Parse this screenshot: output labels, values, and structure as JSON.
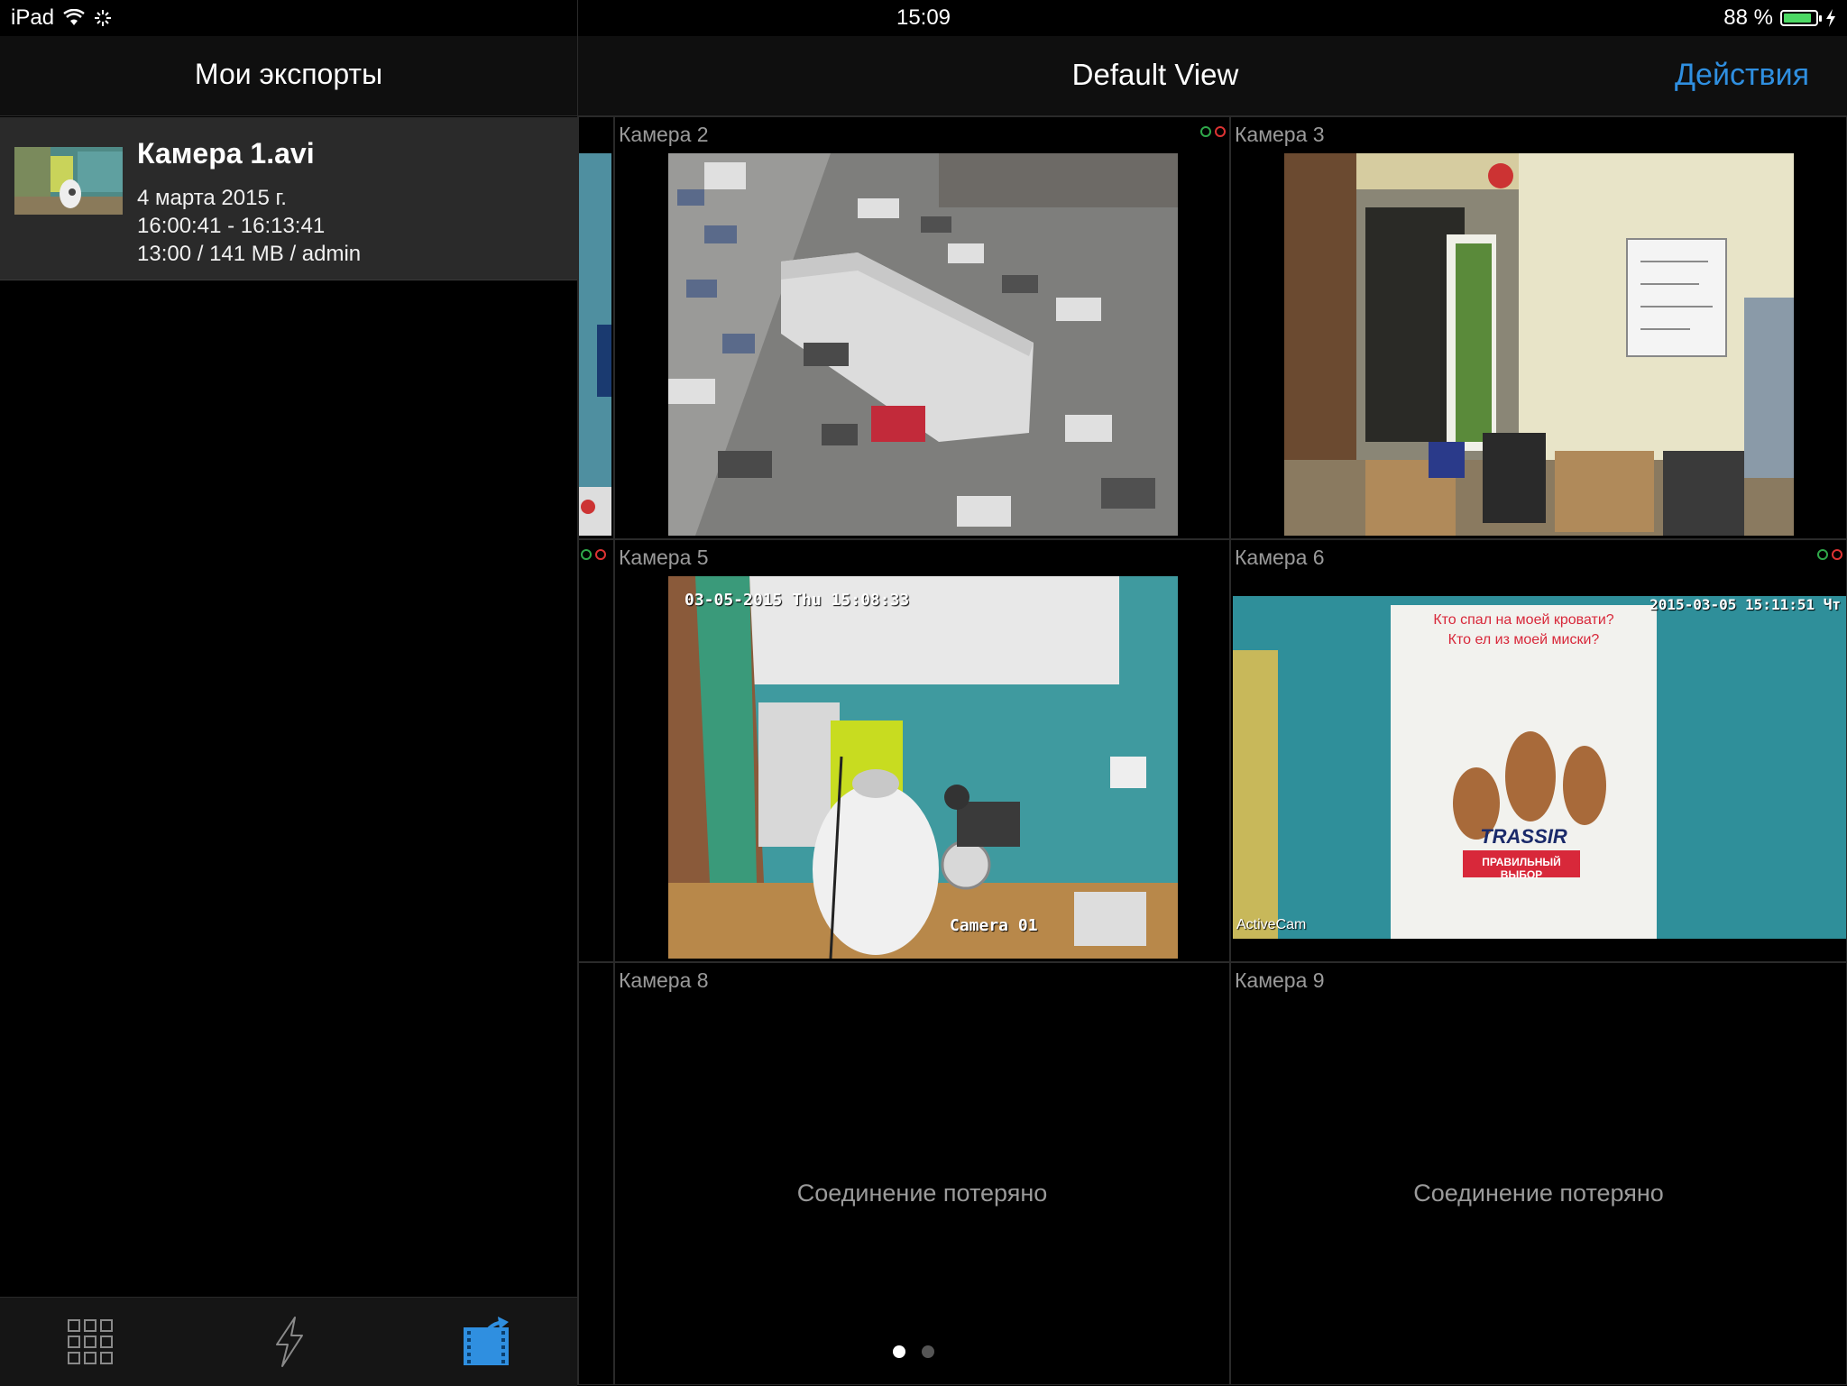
{
  "status_bar": {
    "device": "iPad",
    "time": "15:09",
    "battery_percent_text": "88 %",
    "battery_level": 0.88
  },
  "left_panel": {
    "title": "Мои экспорты",
    "exports": [
      {
        "name": "Камера 1.avi",
        "date": "4 марта 2015 г.",
        "time_range": "16:00:41 - 16:13:41",
        "details": "13:00 / 141 MB / admin"
      }
    ],
    "toolbar": {
      "items": [
        {
          "icon": "grid-icon",
          "active": false
        },
        {
          "icon": "lightning-icon",
          "active": false
        },
        {
          "icon": "export-film-icon",
          "active": true
        }
      ],
      "accent": "#2f8fe0"
    }
  },
  "right_panel": {
    "view_title": "Default View",
    "actions_label": "Действия",
    "cameras": [
      {
        "label": "Камера 2"
      },
      {
        "label": "Камера 3"
      },
      {
        "label": "Камера 5",
        "osd_top": "03-05-2015 Thu 15:08:33",
        "osd_bottom": "Camera 01"
      },
      {
        "label": "Камера 6",
        "osd_top": "2015-03-05 15:11:51 Чт",
        "osd_bottom": "ActiveCam",
        "poster_line1": "Кто спал на моей кровати?",
        "poster_line2": "Кто ел из моей миски?",
        "poster_brand": "TRASSIR",
        "poster_badge": "ПРАВИЛЬНЫЙ ВЫБОР"
      },
      {
        "label": "Камера 8",
        "status": "Соединение потеряно"
      },
      {
        "label": "Камера 9",
        "status": "Соединение потеряно"
      }
    ],
    "pages": {
      "count": 2,
      "current": 1
    }
  }
}
